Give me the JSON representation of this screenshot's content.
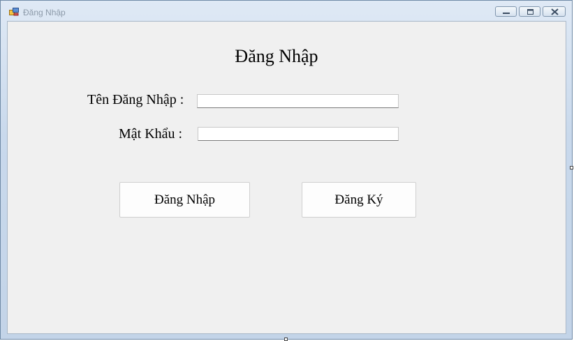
{
  "window": {
    "title": "Đăng Nhập",
    "controls": {
      "minimize": "minimize-icon",
      "maximize": "maximize-icon",
      "close": "close-icon"
    }
  },
  "form": {
    "heading": "Đăng Nhập",
    "username_label": "Tên Đăng Nhập :",
    "username_value": "",
    "password_label": "Mật Khẩu :",
    "password_value": "",
    "login_button": "Đăng Nhập",
    "register_button": "Đăng Ký"
  },
  "colors": {
    "client_background": "#f0f0f0",
    "titlebar": "#c9d9ec",
    "title_text": "#8c9aa9"
  }
}
